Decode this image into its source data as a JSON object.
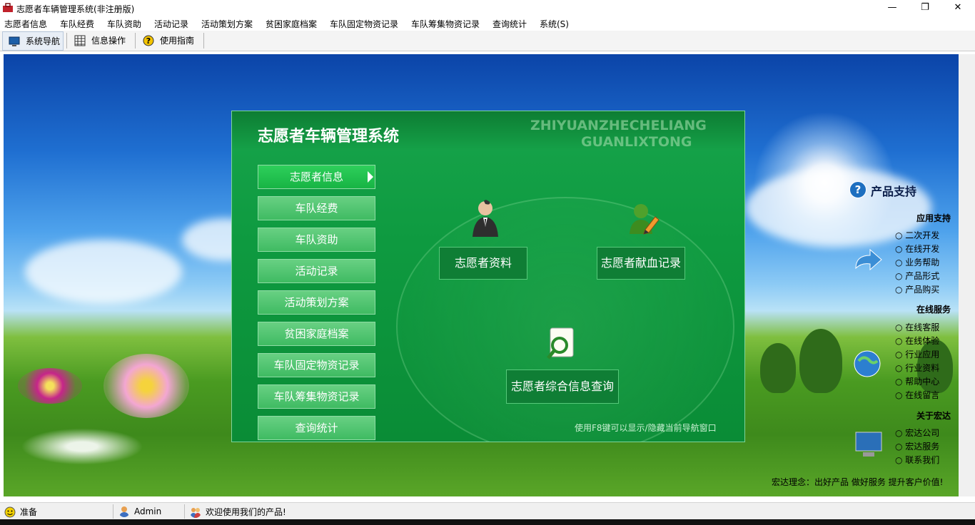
{
  "window": {
    "title": "志愿者车辆管理系统(非注册版)",
    "minimize_glyph": "—",
    "maximize_glyph": "❐",
    "close_glyph": "✕"
  },
  "menu": [
    "志愿者信息",
    "车队经费",
    "车队资助",
    "活动记录",
    "活动策划方案",
    "贫困家庭档案",
    "车队固定物资记录",
    "车队筹集物资记录",
    "查询统计",
    "系统(S)"
  ],
  "toolbar": {
    "items": [
      "系统导航",
      "信息操作",
      "使用指南"
    ],
    "active": "系统导航"
  },
  "panel": {
    "title": "志愿者车辆管理系统",
    "pinyin_line1": "ZHIYUANZHECHELIANG",
    "pinyin_line2": "GUANLIXTONG",
    "nav": [
      "志愿者信息",
      "车队经费",
      "车队资助",
      "活动记录",
      "活动策划方案",
      "贫困家庭档案",
      "车队固定物资记录",
      "车队筹集物资记录",
      "查询统计"
    ],
    "active_nav": "志愿者信息",
    "buttons": {
      "profile": "志愿者资料",
      "blood": "志愿者献血记录",
      "query": "志愿者综合信息查询"
    },
    "hint": "使用F8键可以显示/隐藏当前导航窗口"
  },
  "support": {
    "title": "产品支持",
    "sections": [
      {
        "heading": "应用支持",
        "links": [
          "二次开发",
          "在线开发",
          "业务帮助",
          "产品形式",
          "产品购买"
        ]
      },
      {
        "heading": "在线服务",
        "links": [
          "在线客服",
          "在线体验",
          "行业应用",
          "行业资料",
          "帮助中心",
          "在线留言"
        ]
      },
      {
        "heading": "关于宏达",
        "links": [
          "宏达公司",
          "宏达服务",
          "联系我们"
        ]
      }
    ],
    "motto": "宏达理念：出好产品 做好服务 提升客户价值!"
  },
  "status": {
    "ready": "准备",
    "user": "Admin",
    "welcome": "欢迎使用我们的产品!"
  },
  "colors": {
    "panel_green": "#0e9a40",
    "button_green": "#0f7e35",
    "sky_blue": "#1f6fd1",
    "grass_green": "#4a9b21"
  }
}
